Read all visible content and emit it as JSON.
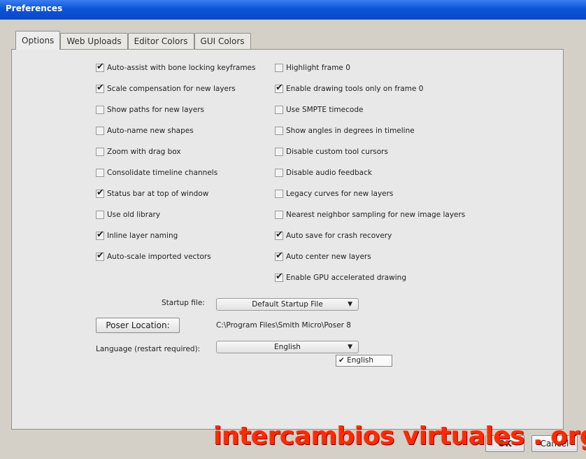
{
  "window": {
    "title": "Preferences"
  },
  "tabs": [
    "Options",
    "Web Uploads",
    "Editor Colors",
    "GUI Colors"
  ],
  "left_options": [
    {
      "label": "Auto-assist with bone locking keyframes",
      "checked": true
    },
    {
      "label": "Scale compensation for new layers",
      "checked": true
    },
    {
      "label": "Show paths for new layers",
      "checked": false
    },
    {
      "label": "Auto-name new shapes",
      "checked": false
    },
    {
      "label": "Zoom with drag box",
      "checked": false
    },
    {
      "label": "Consolidate timeline channels",
      "checked": false
    },
    {
      "label": "Status bar at top of window",
      "checked": true
    },
    {
      "label": "Use old library",
      "checked": false
    },
    {
      "label": "Inline layer naming",
      "checked": true
    },
    {
      "label": "Auto-scale imported vectors",
      "checked": true
    }
  ],
  "right_options": [
    {
      "label": "Highlight frame 0",
      "checked": false
    },
    {
      "label": "Enable drawing tools only on frame 0",
      "checked": true
    },
    {
      "label": "Use SMPTE timecode",
      "checked": false
    },
    {
      "label": "Show angles in degrees in timeline",
      "checked": false
    },
    {
      "label": "Disable custom tool cursors",
      "checked": false
    },
    {
      "label": "Disable audio feedback",
      "checked": false
    },
    {
      "label": "Legacy curves for new layers",
      "checked": false
    },
    {
      "label": "Nearest neighbor sampling for new image layers",
      "checked": false
    },
    {
      "label": "Auto save for crash recovery",
      "checked": true
    },
    {
      "label": "Auto center new layers",
      "checked": true
    },
    {
      "label": "Enable GPU accelerated drawing",
      "checked": true
    }
  ],
  "startup": {
    "label": "Startup file:",
    "value": "Default Startup File",
    "arrow": "▼"
  },
  "poser": {
    "button": "Poser Location:",
    "path": "C:\\Program Files\\Smith Micro\\Poser 8"
  },
  "language": {
    "label": "Language (restart required):",
    "value": "English",
    "arrow": "▼",
    "menu_item": "✔ English"
  },
  "buttons": {
    "ok": "OK",
    "cancel": "Cancel"
  },
  "watermark": "intercambios virtuales . org"
}
